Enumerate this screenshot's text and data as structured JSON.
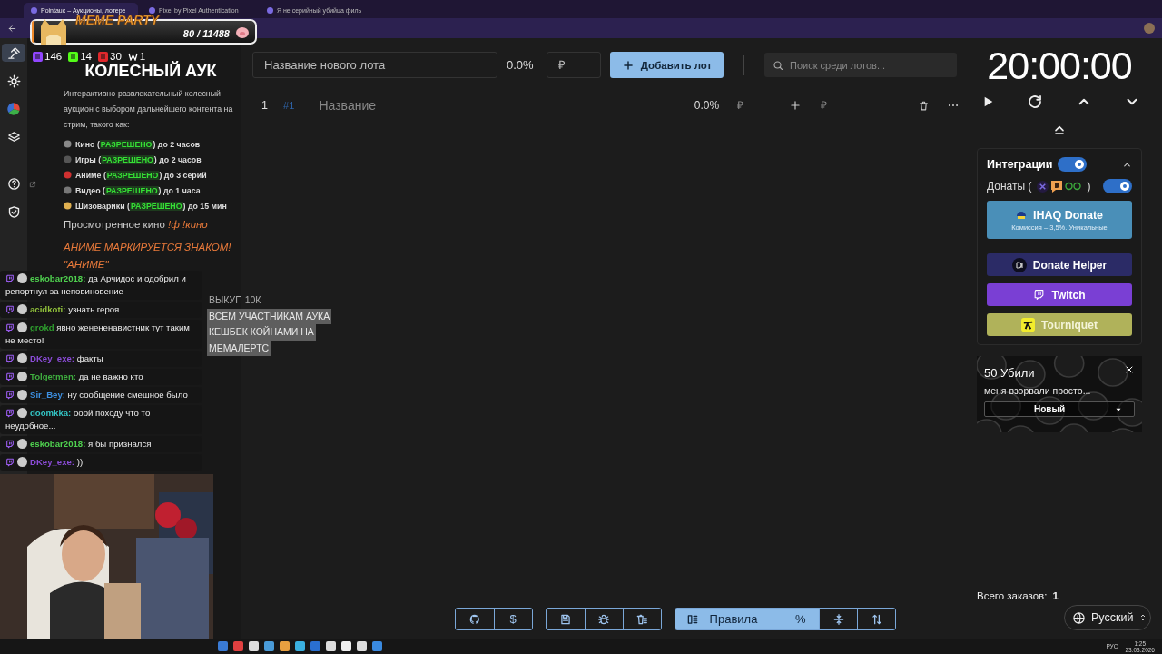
{
  "browser": {
    "tabs": [
      {
        "title": "Pointauc – Аукционы, лотере",
        "selected": true
      },
      {
        "title": "Pixel by Pixel Authentication",
        "selected": false
      },
      {
        "title": "Я не серийный убийца филь",
        "selected": false
      }
    ]
  },
  "overlay": {
    "widget": {
      "title": "MEME PARTY",
      "progress": "80 / 11488",
      "level": 0.007
    },
    "stats": [
      {
        "kind": "twitch",
        "value": "146"
      },
      {
        "kind": "kick",
        "value": "14"
      },
      {
        "kind": "vk",
        "value": "30"
      },
      {
        "kind": "w",
        "value": "1"
      }
    ],
    "announcement": [
      "ВЫКУП 10К",
      "ВСЕМ УЧАСТНИКАМ АУКА",
      "КЕШБЕК КОЙНАМИ НА",
      "МЕМАЛЕРТС"
    ],
    "chat": [
      {
        "user": "eskobar2018:",
        "color": "#4fd14f",
        "text": "да Арчидос и одобрил и репортнул за неповиновение"
      },
      {
        "user": "acidkoti:",
        "color": "#8fbf3a",
        "text": "узнать героя"
      },
      {
        "user": "grokd",
        "color": "#2e9e2e",
        "text": "явно женененавистник тут таким не место!"
      },
      {
        "user": "DKey_exe:",
        "color": "#8a4bd6",
        "text": "факты"
      },
      {
        "user": "Tolgetmen:",
        "color": "#3fae3f",
        "text": "да не важно кто"
      },
      {
        "user": "Sir_Bey:",
        "color": "#3d8fe0",
        "text": "ну сообщение смешное было"
      },
      {
        "user": "doomkka:",
        "color": "#33c6c6",
        "text": "ооой походу что то неудобное..."
      },
      {
        "user": "eskobar2018:",
        "color": "#4fd14f",
        "text": "я бы признался"
      },
      {
        "user": "DKey_exe:",
        "color": "#8a4bd6",
        "text": "))"
      }
    ],
    "webcam": {
      "kind": "picture"
    }
  },
  "sidebar": {
    "items": [
      {
        "kind": "auction",
        "selected": true
      },
      {
        "kind": "settings",
        "selected": false
      },
      {
        "kind": "stats",
        "selected": false
      },
      {
        "kind": "layers",
        "selected": false
      },
      {
        "kind": "help",
        "selected": false
      },
      {
        "kind": "shield",
        "selected": false
      }
    ]
  },
  "rules": {
    "title": "КОЛЕСНЫЙ АУК",
    "intro": "Интерактивно-развлекательный колесный аукцион с выбором дальнейшего контента на стрим, такого как:",
    "items": [
      {
        "kind": "film",
        "before": "Кино (",
        "badge": "РАЗРЕШЕНО",
        "after": ") до 2 часов"
      },
      {
        "kind": "game",
        "before": "Игры (",
        "badge": "РАЗРЕШЕНО",
        "after": ") до 2 часов"
      },
      {
        "kind": "anime",
        "before": "Аниме (",
        "badge": "РАЗРЕШЕНО",
        "after": ") до 3 серий"
      },
      {
        "kind": "video",
        "before": "Видео (",
        "badge": "РАЗРЕШЕНО",
        "after": ") до 1 часа"
      },
      {
        "kind": "crazy",
        "before": "Шизоварики (",
        "badge": "РАЗРЕШЕНО",
        "after": ") до 15 мин"
      }
    ],
    "watched": {
      "text": "Просмотренное кино",
      "command": "!ф !кино"
    },
    "notice": [
      "АНИМЕ МАРКИРУЕТСЯ ЗНАКОМ!",
      "\"АНИМЕ\""
    ]
  },
  "new_lot": {
    "name_placeholder": "Название нового лота",
    "percent": "0.0%",
    "amount_placeholder": "₽",
    "add_button": "Добавить лот",
    "search_placeholder": "Поиск среди лотов..."
  },
  "lots": [
    {
      "index": "1",
      "id": "#1",
      "name_placeholder": "Название",
      "percent": "0.0%",
      "amount_placeholder": "₽",
      "extra_placeholder": "₽"
    }
  ],
  "timer": {
    "time": "20:00:00"
  },
  "integrations": {
    "title": "Интеграции",
    "enabled": true,
    "expanded": true,
    "donations_label": "Донаты (",
    "donations_suffix": ")",
    "donations_enabled": true,
    "services": [
      {
        "kind": "ihaq",
        "name": "IHAQ Donate",
        "note": "Комиссия – 3,5%. Уникальные",
        "color": "#4a8fb8"
      },
      {
        "kind": "donatehelper",
        "name": "Donate Helper",
        "color": "#2b2b66"
      },
      {
        "kind": "twitch",
        "name": "Twitch",
        "color": "#7a3fd4"
      },
      {
        "kind": "tourniquet",
        "name": "Tourniquet",
        "color": "#b0b25a"
      }
    ]
  },
  "notification": {
    "title": "50 Убили",
    "message": "меня взорвали просто...",
    "status": "Новый"
  },
  "orders": {
    "label": "Всего заказов:",
    "count": "1"
  },
  "language": "Русский",
  "toolbar": {
    "groups": [
      [
        {
          "kind": "github",
          "selected": false
        },
        {
          "kind": "donate",
          "label": "$",
          "selected": false
        }
      ],
      [
        {
          "kind": "save",
          "selected": false
        },
        {
          "kind": "bug",
          "selected": false
        },
        {
          "kind": "clear",
          "selected": false
        }
      ],
      [
        {
          "kind": "rules",
          "label": "Правила",
          "selected": true
        },
        {
          "kind": "percent",
          "label": "%",
          "selected": true
        },
        {
          "kind": "compress",
          "selected": false
        },
        {
          "kind": "sort",
          "selected": false
        }
      ]
    ]
  },
  "taskbar": {
    "lang": "РУС",
    "time": "1:25",
    "date": "23.03.2026"
  }
}
